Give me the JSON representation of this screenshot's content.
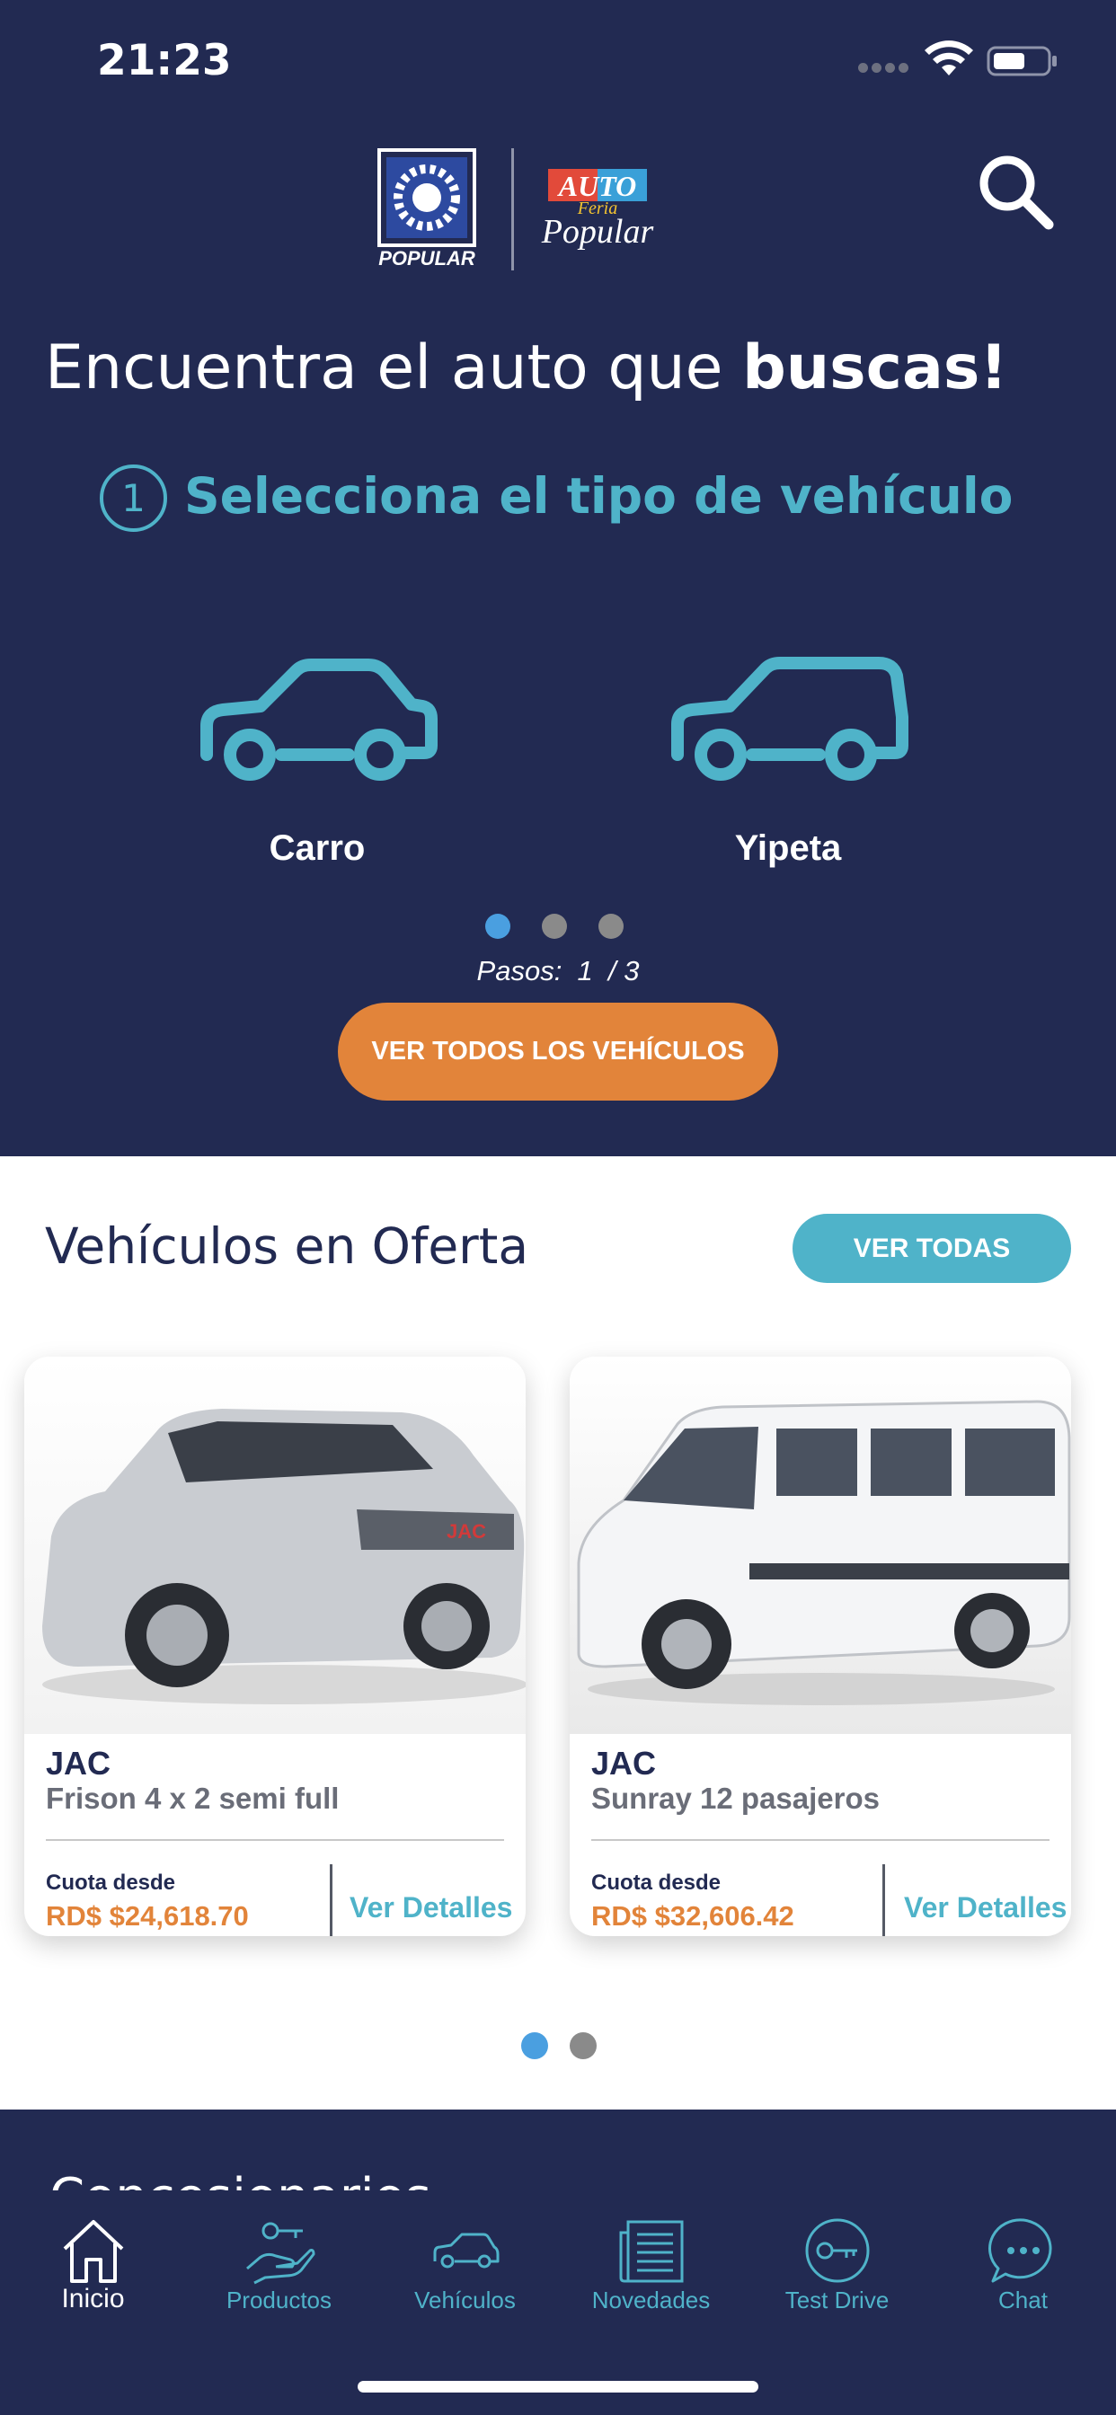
{
  "status_bar": {
    "time": "21:23"
  },
  "header": {
    "logo_popular_text": "POPULAR",
    "logo_autoferia_text": [
      "AUTO",
      "Feria",
      "Popular"
    ]
  },
  "hero": {
    "headline_regular": "Encuentra el auto que ",
    "headline_bold": "buscas!",
    "step_number": "1",
    "step_title": "Selecciona el tipo de vehículo",
    "vehicle_types": [
      {
        "label": "Carro",
        "icon": "car-icon"
      },
      {
        "label": "Yipeta",
        "icon": "suv-icon"
      }
    ],
    "step_dots": {
      "total": 3,
      "active": 1
    },
    "pasos": "Pasos:  1  / 3",
    "view_all_button": "VER TODOS LOS VEHÍCULOS"
  },
  "offers": {
    "title": "Vehículos en Oferta",
    "see_all_button": "VER TODAS",
    "cards": [
      {
        "brand": "JAC",
        "model": "Frison 4 x 2 semi full",
        "cuota_label": "Cuota desde",
        "price": "RD$ $24,618.70",
        "details_link": "Ver Detalles",
        "image": "silver-pickup-photo"
      },
      {
        "brand": "JAC",
        "model": "Sunray 12 pasajeros",
        "cuota_label": "Cuota desde",
        "price": "RD$ $32,606.42",
        "details_link": "Ver Detalles",
        "image": "white-van-photo"
      }
    ],
    "page_dots": {
      "total": 2,
      "active": 1
    }
  },
  "dealers": {
    "title": "Concesionarios"
  },
  "tabbar": {
    "tabs": [
      {
        "label": "Inicio",
        "icon": "home-icon",
        "active": true
      },
      {
        "label": "Productos",
        "icon": "hand-key-icon",
        "active": false
      },
      {
        "label": "Vehículos",
        "icon": "car-icon",
        "active": false
      },
      {
        "label": "Novedades",
        "icon": "newspaper-icon",
        "active": false
      },
      {
        "label": "Test Drive",
        "icon": "key-icon",
        "active": false
      },
      {
        "label": "Chat",
        "icon": "chat-bubble-icon",
        "active": false
      }
    ]
  },
  "colors": {
    "navy": "#222a52",
    "teal": "#4fb3c9",
    "orange": "#e2843a",
    "dot_active": "#4a9fe0",
    "dot_inactive": "#8a8a8a"
  }
}
